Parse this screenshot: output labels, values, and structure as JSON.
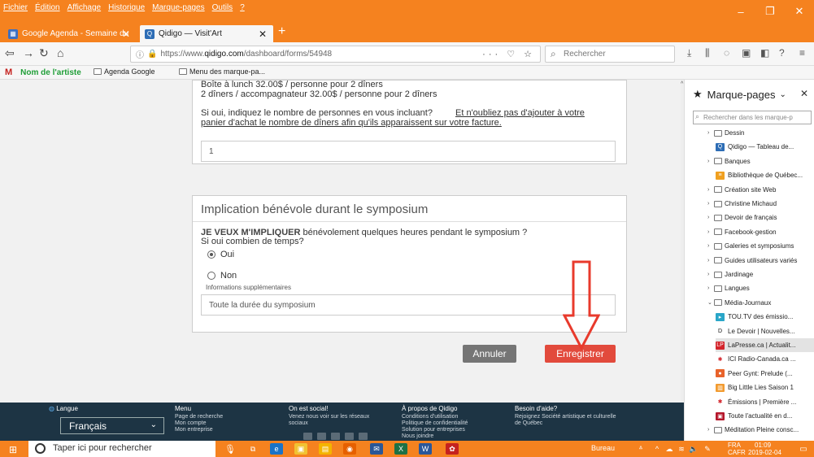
{
  "menubar": {
    "items": [
      "Fichier",
      "Édition",
      "Affichage",
      "Historique",
      "Marque-pages",
      "Outils",
      "?"
    ]
  },
  "window_controls": {
    "minimize": "–",
    "restore": "❐",
    "close": "✕"
  },
  "tabs": [
    {
      "label": "Google Agenda - Semaine du",
      "icon": "calendar-icon",
      "active": false
    },
    {
      "label": "Qidigo — Visit'Art",
      "icon": "qidigo-icon",
      "active": true
    }
  ],
  "newtab_label": "+",
  "navbar": {
    "url_prefix": "https://www.",
    "url_domain": "qidigo.com",
    "url_path": "/dashboard/forms/54948",
    "url_actions": "··· ♡ ☆",
    "search_placeholder": "Rechercher"
  },
  "bookmarks_bar": {
    "item1": "Nom de l'artiste",
    "item2": "Agenda Google",
    "item3": "Menu des marque-pa..."
  },
  "form": {
    "card1_line1": "Boîte à lunch 32.00$ / personne pour 2 dîners",
    "card1_line2": "2 dîners / accompagnateur 32.00$ / personne pour 2 dîners",
    "card1_q1": "Si oui, indiquez le nombre de personnes en vous incluant?",
    "card1_link1": "Et n'oubliez pas d'ajouter à votre",
    "card1_link2": "panier d'achat le nombre de dîners afin qu'ils apparaissent sur votre facture.",
    "card1_input_value": "1",
    "card2_title": "Implication bénévole durant le symposium",
    "card2_q_bold": "JE VEUX M'IMPLIQUER",
    "card2_q_rest": " bénévolement quelques heures pendant le symposium ?",
    "card2_q_line2": "Si oui combien de temps?",
    "radio_yes": "Oui",
    "radio_no": "Non",
    "radio_selected": "Oui",
    "extra_label": "Informations supplémentaires",
    "extra_value": "Toute la durée du symposium",
    "cancel_label": "Annuler",
    "save_label": "Enregistrer"
  },
  "footer": {
    "lang_title": "Langue",
    "lang_value": "Français",
    "menu_title": "Menu",
    "menu_items": [
      "Page de recherche",
      "Mon compte",
      "Mon entreprise"
    ],
    "social_title": "On est social!",
    "social_text": "Venez nous voir sur les réseaux sociaux",
    "about_title": "À propos de Qidigo",
    "about_items": [
      "Conditions d'utilisation",
      "Politique de confidentialité",
      "Solution pour entreprises",
      "Nous joindre"
    ],
    "help_title": "Besoin d'aide?",
    "help_text": "Rejoignez Société artistique et culturelle de Québec"
  },
  "sidebar": {
    "title": "Marque-pages",
    "search_placeholder": "Rechercher dans les marque-p",
    "items": [
      {
        "label": "Dessin",
        "type": "folder",
        "indent": 1
      },
      {
        "label": "Qidigo — Tableau de...",
        "type": "qidigo",
        "indent": 2
      },
      {
        "label": "Banques",
        "type": "folder",
        "indent": 1
      },
      {
        "label": "Bibliothèque de Québec...",
        "type": "biblio",
        "indent": 2
      },
      {
        "label": "Création site Web",
        "type": "folder",
        "indent": 1
      },
      {
        "label": "Christine Michaud",
        "type": "folder",
        "indent": 1
      },
      {
        "label": "Devoir de français",
        "type": "folder",
        "indent": 1
      },
      {
        "label": "Facebook-gestion",
        "type": "folder",
        "indent": 1
      },
      {
        "label": "Galeries et symposiums",
        "type": "folder",
        "indent": 1
      },
      {
        "label": "Guides utilisateurs variés",
        "type": "folder",
        "indent": 1
      },
      {
        "label": "Jardinage",
        "type": "folder",
        "indent": 1
      },
      {
        "label": "Langues",
        "type": "folder",
        "indent": 1
      },
      {
        "label": "Média-Journaux",
        "type": "folder-open",
        "indent": 1
      },
      {
        "label": "TOU.TV des émissio...",
        "type": "toutv",
        "indent": 2
      },
      {
        "label": "Le Devoir | Nouvelles...",
        "type": "devoir",
        "indent": 2
      },
      {
        "label": "LaPresse.ca | Actualit...",
        "type": "lapresse",
        "indent": 2
      },
      {
        "label": "ICI Radio-Canada.ca ...",
        "type": "radiocan",
        "indent": 2
      },
      {
        "label": "Peer Gynt: Prelude (...",
        "type": "peer",
        "indent": 2
      },
      {
        "label": "Big Little Lies Saison 1",
        "type": "big",
        "indent": 2
      },
      {
        "label": "Émissions | Première ...",
        "type": "radiocan",
        "indent": 2
      },
      {
        "label": "Toute l'actualité en d...",
        "type": "tva",
        "indent": 2
      },
      {
        "label": "Méditation Pleine consc...",
        "type": "folder",
        "indent": 1
      }
    ]
  },
  "taskbar": {
    "search_placeholder": "Taper ici pour rechercher",
    "bureau": "Bureau",
    "lang_line1": "FRA",
    "lang_line2": "CAFR",
    "time": "01:09",
    "date": "2019-02-04"
  },
  "colors": {
    "chrome_orange": "#f5821f",
    "save_red": "#e24a3c",
    "cancel_gray": "#757575",
    "footer_navy": "#1d3444",
    "annotation_red": "#e83a2c"
  }
}
